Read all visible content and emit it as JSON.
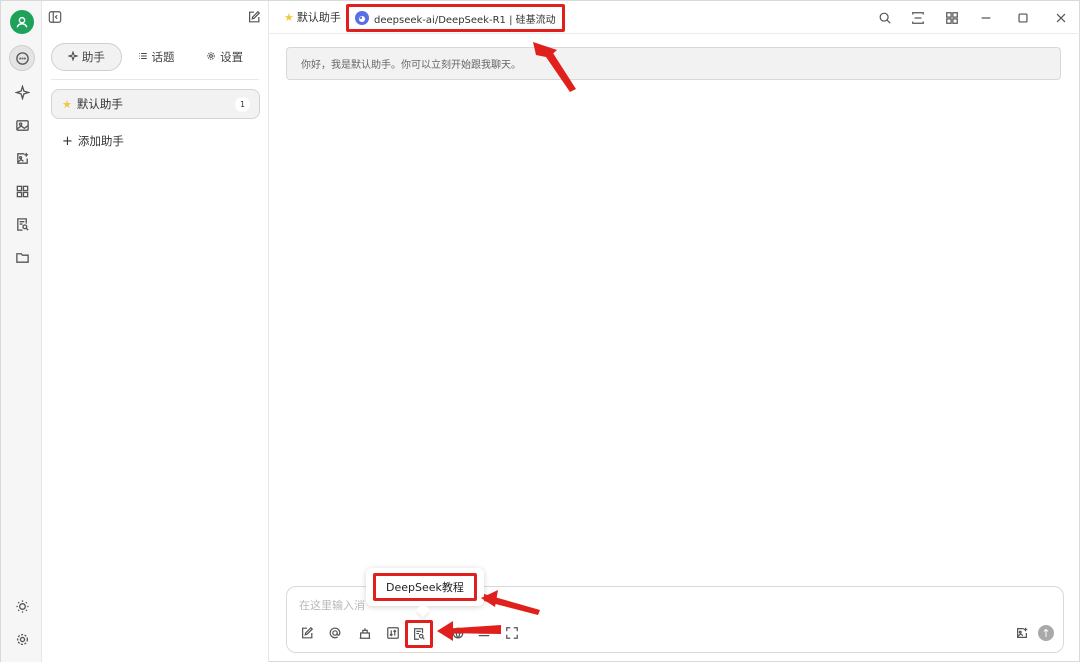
{
  "sidebar_tabs": [
    {
      "label": "助手",
      "icon": "sparkle-icon"
    },
    {
      "label": "话题",
      "icon": "list-icon"
    },
    {
      "label": "设置",
      "icon": "gear-icon"
    }
  ],
  "assistant_list": {
    "items": [
      {
        "label": "默认助手",
        "count": "1",
        "icon": "star-icon"
      }
    ],
    "add_label": "添加助手"
  },
  "header": {
    "assistant_name": "默认助手",
    "model_label": "deepseek-ai/DeepSeek-R1 | 硅基流动"
  },
  "chat": {
    "greeting": "你好，我是默认助手。你可以立刻开始跟我聊天。"
  },
  "composer": {
    "placeholder": "在这里输入消",
    "tooltip": "DeepSeek教程"
  },
  "colors": {
    "accent": "#1fa15c",
    "annotation": "#e0201d"
  }
}
